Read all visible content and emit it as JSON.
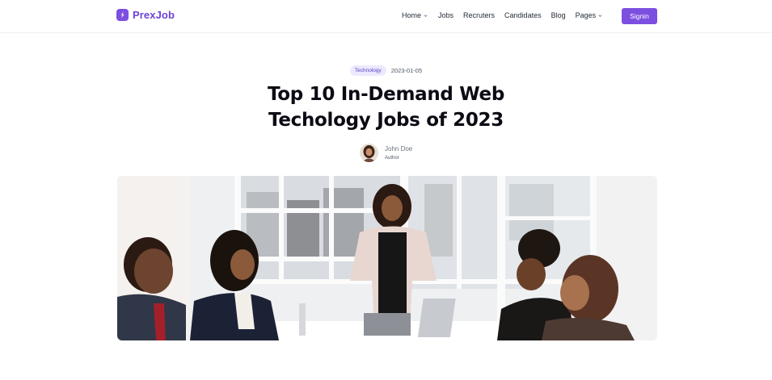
{
  "brand": {
    "name": "PrexJob",
    "color": "#7c4fe0"
  },
  "nav": {
    "items": [
      {
        "label": "Home",
        "dropdown": true
      },
      {
        "label": "Jobs",
        "dropdown": false
      },
      {
        "label": "Recruters",
        "dropdown": false
      },
      {
        "label": "Candidates",
        "dropdown": false
      },
      {
        "label": "Blog",
        "dropdown": false
      },
      {
        "label": "Pages",
        "dropdown": true
      }
    ],
    "signin_label": "Signin"
  },
  "post": {
    "tag": "Technology",
    "date": "2023-01-05",
    "title_line1": "Top 10 In-Demand Web",
    "title_line2": "Techology Jobs of 2023",
    "author": {
      "name": "John Doe",
      "role": "Author"
    },
    "image": "office-meeting-photo"
  }
}
